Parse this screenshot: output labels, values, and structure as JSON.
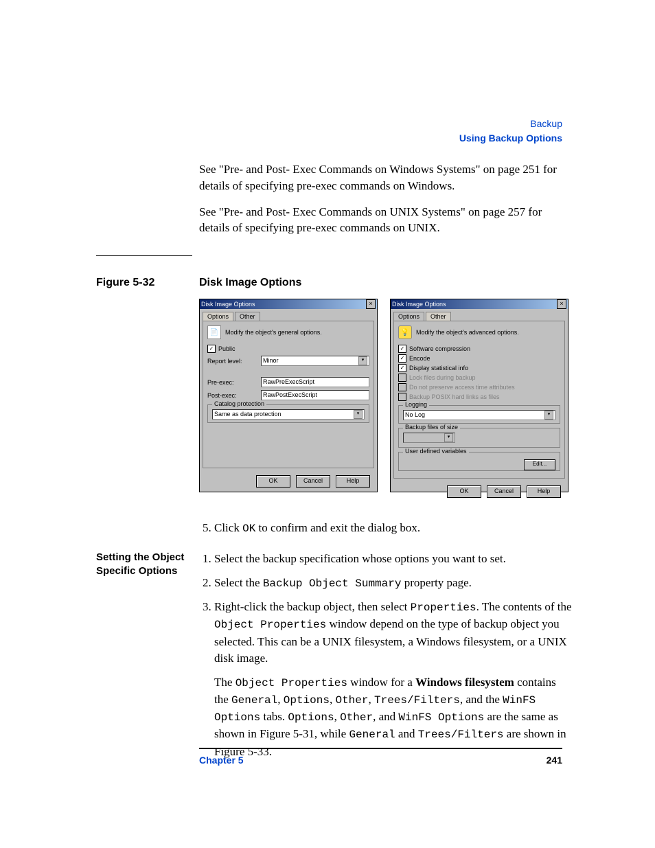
{
  "header": {
    "breadcrumb": "Backup",
    "section": "Using Backup Options"
  },
  "intro": {
    "p1": "See \"Pre- and Post- Exec Commands on Windows Systems\" on page 251 for details of specifying pre-exec commands on Windows.",
    "p2": "See \"Pre- and Post- Exec Commands on UNIX Systems\" on page 257 for details of specifying pre-exec commands on UNIX."
  },
  "figure": {
    "label": "Figure 5-32",
    "title": "Disk Image Options"
  },
  "dialog_left": {
    "title": "Disk Image Options",
    "tabs": [
      "Options",
      "Other"
    ],
    "active_tab": 0,
    "message": "Modify the object's general options.",
    "public_label": "Public",
    "report_level_label": "Report level:",
    "report_level_value": "Minor",
    "preexec_label": "Pre-exec:",
    "preexec_value": "RawPreExecScript",
    "postexec_label": "Post-exec:",
    "postexec_value": "RawPostExecScript",
    "catalog_group": "Catalog protection",
    "catalog_value": "Same as data protection",
    "buttons": {
      "ok": "OK",
      "cancel": "Cancel",
      "help": "Help"
    }
  },
  "dialog_right": {
    "title": "Disk Image Options",
    "tabs": [
      "Options",
      "Other"
    ],
    "active_tab": 1,
    "message": "Modify the object's advanced options.",
    "checkboxes": [
      {
        "label": "Software compression",
        "checked": true,
        "enabled": true
      },
      {
        "label": "Encode",
        "checked": true,
        "enabled": true
      },
      {
        "label": "Display statistical info",
        "checked": true,
        "enabled": true
      },
      {
        "label": "Lock files during backup",
        "checked": false,
        "enabled": false
      },
      {
        "label": "Do not preserve access time attributes",
        "checked": false,
        "enabled": false
      },
      {
        "label": "Backup POSIX hard links as files",
        "checked": false,
        "enabled": false
      }
    ],
    "logging_group": "Logging",
    "logging_value": "No Log",
    "backup_size_group": "Backup files of size",
    "userdef_group": "User defined variables",
    "edit_button": "Edit...",
    "buttons": {
      "ok": "OK",
      "cancel": "Cancel",
      "help": "Help"
    }
  },
  "step5": {
    "prefix": "Click ",
    "code": "OK",
    "suffix": " to confirm and exit the dialog box."
  },
  "sidebar_heading": "Setting the Object Specific Options",
  "steps": {
    "s1": "Select the backup specification whose options you want to set.",
    "s2_a": "Select the ",
    "s2_code": "Backup Object Summary",
    "s2_b": " property page.",
    "s3_a": "Right-click the backup object, then select ",
    "s3_code1": "Properties",
    "s3_b": ". The contents of the ",
    "s3_code2": "Object Properties",
    "s3_c": " window depend on the type of backup object you selected. This can be a UNIX filesystem, a Windows filesystem, or a UNIX disk image.",
    "s3p2_a": "The ",
    "s3p2_code1": "Object Properties",
    "s3p2_b": " window for a ",
    "s3p2_bold": "Windows filesystem",
    "s3p2_c": " contains the ",
    "s3p2_code2": "General",
    "s3p2_d": ", ",
    "s3p2_code3": "Options",
    "s3p2_e": ", ",
    "s3p2_code4": "Other",
    "s3p2_f": ", ",
    "s3p2_code5": "Trees/Filters",
    "s3p2_g": ", and the ",
    "s3p2_code6": "WinFS Options",
    "s3p2_h": " tabs. ",
    "s3p2_code7": "Options",
    "s3p2_i": ", ",
    "s3p2_code8": "Other",
    "s3p2_j": ", and ",
    "s3p2_code9": "WinFS Options",
    "s3p2_k": " are the same as shown in Figure 5-31, while ",
    "s3p2_code10": "General",
    "s3p2_l": " and ",
    "s3p2_code11": "Trees/Filters",
    "s3p2_m": " are shown in Figure 5-33."
  },
  "footer": {
    "chapter": "Chapter 5",
    "page": "241"
  }
}
